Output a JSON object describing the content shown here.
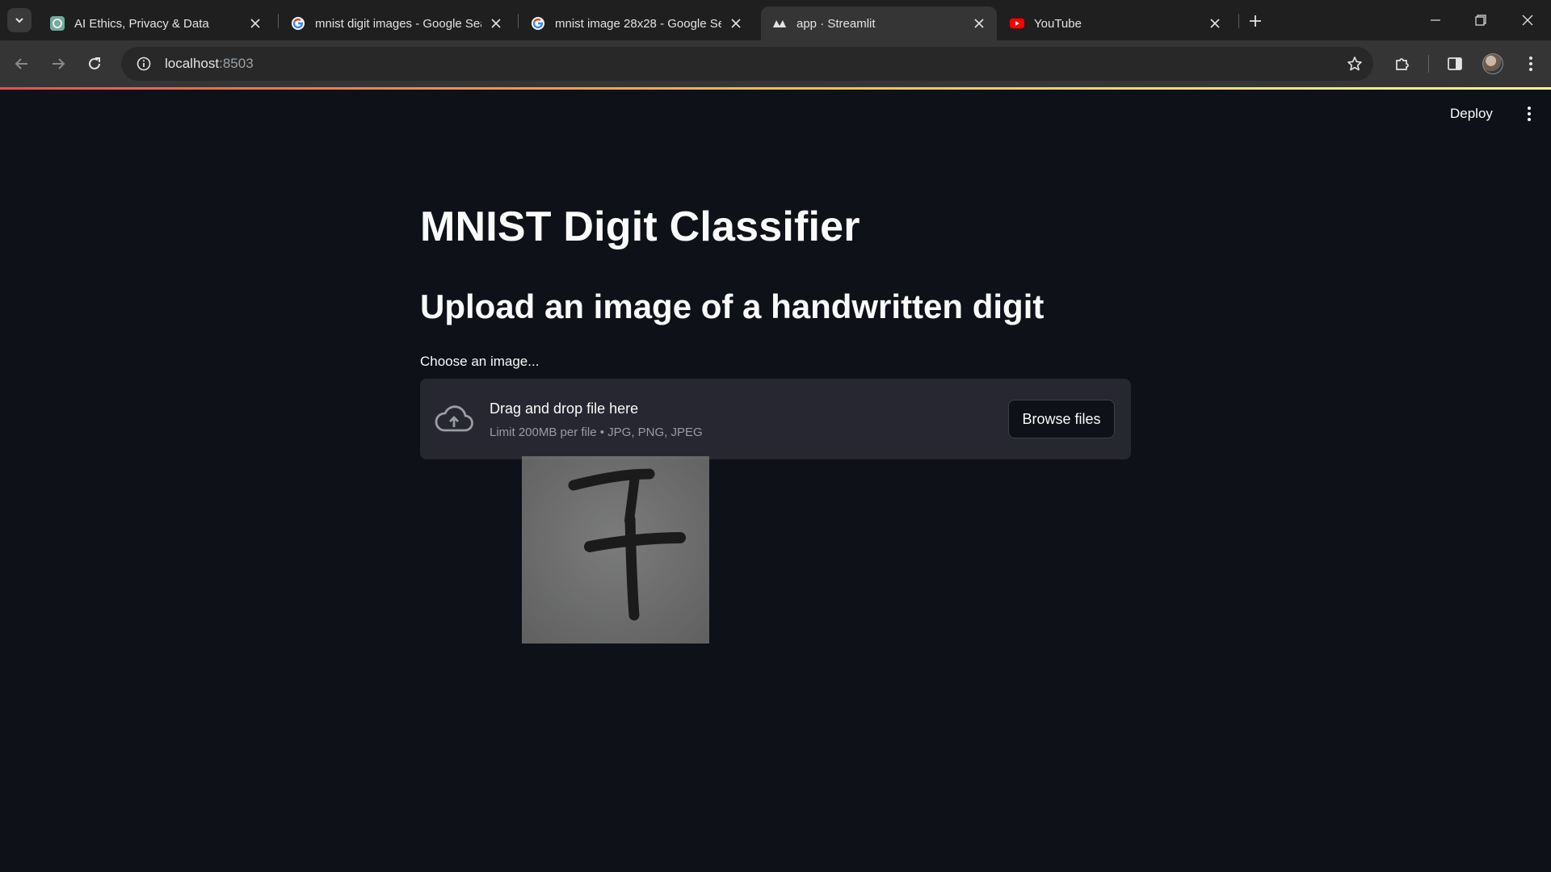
{
  "browser": {
    "tabs": [
      {
        "title": "AI Ethics, Privacy & Data",
        "favicon": "chatgpt-icon"
      },
      {
        "title": "mnist digit images - Google Search",
        "favicon": "google-icon"
      },
      {
        "title": "mnist image 28x28 - Google Search",
        "favicon": "google-icon"
      },
      {
        "title": "app · Streamlit",
        "favicon": "streamlit-icon",
        "active": true
      },
      {
        "title": "YouTube",
        "favicon": "youtube-icon"
      }
    ],
    "url_host": "localhost",
    "url_port": ":8503"
  },
  "app": {
    "deploy_label": "Deploy",
    "title": "MNIST Digit Classifier",
    "subtitle": "Upload an image of a handwritten digit",
    "uploader": {
      "label": "Choose an image...",
      "drag_text": "Drag and drop file here",
      "limit_text": "Limit 200MB per file • JPG, PNG, JPEG",
      "browse_label": "Browse files"
    },
    "dragged_image": {
      "depicts": "handwritten digit 7",
      "background": "#7a7a7a"
    }
  },
  "colors": {
    "app_bg": "#0e1117",
    "dropzone_bg": "#262730",
    "text": "#fafafa",
    "muted_text": "#9a9ca4",
    "accent_red": "#ff4b4b"
  }
}
